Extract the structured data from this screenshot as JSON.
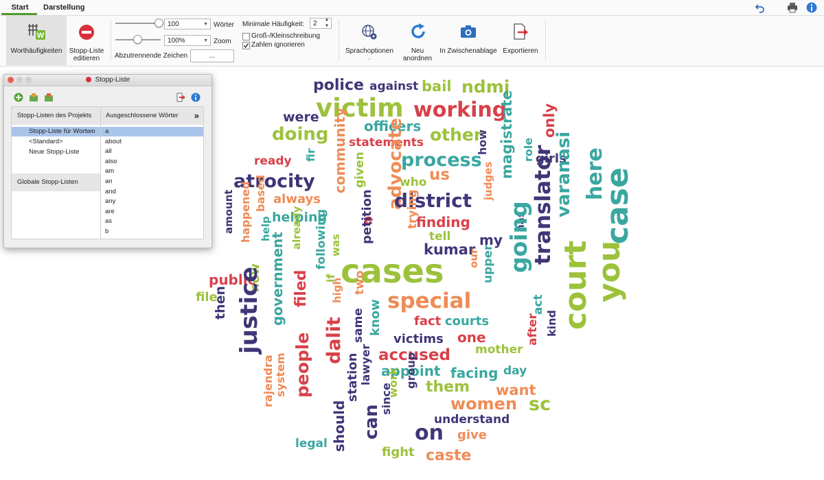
{
  "tabs": {
    "start": "Start",
    "darstellung": "Darstellung"
  },
  "ribbon": {
    "worthaeufigkeiten": "Worthäufigkeiten",
    "stoppliste_editieren": [
      "Stopp-Liste",
      "editieren"
    ],
    "words_value": "100",
    "words_label": "Wörter",
    "zoom_value": "100%",
    "zoom_label": "Zoom",
    "abzutrennende_label": "Abzutrennende Zeichen",
    "abzutrennende_button": "...",
    "min_haeufigkeit_label": "Minimale Häufigkeit:",
    "min_haeufigkeit_value": "2",
    "gross_klein_label": "Groß-/Kleinschreibung",
    "gross_klein_checked": false,
    "zahlen_ignorieren_label": "Zahlen ignorieren",
    "zahlen_ignorieren_checked": true,
    "sprachoptionen": "Sprachoptionen",
    "neu_anordnen": [
      "Neu",
      "anordnen"
    ],
    "in_zwischenablage": "In Zwischenablage",
    "exportieren": "Exportieren"
  },
  "colors": {
    "accent": "#4e9a2a",
    "purple": "#3f3677",
    "green": "#9cc23c",
    "orange": "#ef8c56",
    "teal": "#3aa7a0",
    "red": "#d8414a"
  },
  "stopplist_panel": {
    "title": "Stopp-Liste",
    "left_header": "Stopp-Listen des Projekts",
    "right_header": "Ausgeschlossene Wörter",
    "project_lists": [
      "Stopp-Liste für Wortwo",
      "<Standard>",
      "Neue Stopp-Liste"
    ],
    "global_header": "Globale Stopp-Listen",
    "excluded_words": [
      "a",
      "about",
      "all",
      "also",
      "am",
      "an",
      "and",
      "any",
      "are",
      "as",
      "b"
    ],
    "expand_glyph": "»"
  },
  "cloud": [
    {
      "t": "police",
      "c": "purple"
    },
    {
      "t": "against",
      "c": "purple"
    },
    {
      "t": "bail",
      "c": "green"
    },
    {
      "t": "ndmj",
      "c": "green"
    },
    {
      "t": "victim",
      "c": "green"
    },
    {
      "t": "working",
      "c": "red"
    },
    {
      "t": "were",
      "c": "purple"
    },
    {
      "t": "officers",
      "c": "teal"
    },
    {
      "t": "doing",
      "c": "green"
    },
    {
      "t": "other",
      "c": "green"
    },
    {
      "t": "statements",
      "c": "red"
    },
    {
      "t": "how",
      "c": "purple"
    },
    {
      "t": "magistrate",
      "c": "teal"
    },
    {
      "t": "only",
      "c": "red"
    },
    {
      "t": "ready",
      "c": "red"
    },
    {
      "t": "fir",
      "c": "teal"
    },
    {
      "t": "community",
      "c": "orange"
    },
    {
      "t": "given",
      "c": "green"
    },
    {
      "t": "advocate",
      "c": "orange"
    },
    {
      "t": "process",
      "c": "teal"
    },
    {
      "t": "role",
      "c": "teal"
    },
    {
      "t": "girls",
      "c": "purple"
    },
    {
      "t": "atrocity",
      "c": "purple"
    },
    {
      "t": "us",
      "c": "orange"
    },
    {
      "t": "who",
      "c": "green"
    },
    {
      "t": "judges",
      "c": "orange"
    },
    {
      "t": "varanasi",
      "c": "teal"
    },
    {
      "t": "here",
      "c": "teal"
    },
    {
      "t": "always",
      "c": "orange"
    },
    {
      "t": "district",
      "c": "purple"
    },
    {
      "t": "based",
      "c": "orange"
    },
    {
      "t": "e",
      "c": "red"
    },
    {
      "t": "finding",
      "c": "red"
    },
    {
      "t": "translator",
      "c": "purple"
    },
    {
      "t": "helping",
      "c": "teal"
    },
    {
      "t": "petition",
      "c": "purple"
    },
    {
      "t": "trying",
      "c": "orange"
    },
    {
      "t": "tell",
      "c": "green"
    },
    {
      "t": "has",
      "c": "purple"
    },
    {
      "t": "amount",
      "c": "purple"
    },
    {
      "t": "happened",
      "c": "orange"
    },
    {
      "t": "help",
      "c": "teal"
    },
    {
      "t": "already",
      "c": "green"
    },
    {
      "t": "was",
      "c": "green"
    },
    {
      "t": "kumar",
      "c": "purple"
    },
    {
      "t": "my",
      "c": "purple"
    },
    {
      "t": "case",
      "c": "teal"
    },
    {
      "t": "you",
      "c": "green"
    },
    {
      "t": "following",
      "c": "teal"
    },
    {
      "t": "cases",
      "c": "green"
    },
    {
      "t": "our",
      "c": "orange"
    },
    {
      "t": "going",
      "c": "teal"
    },
    {
      "t": "public",
      "c": "red"
    },
    {
      "t": "upper",
      "c": "teal"
    },
    {
      "t": "court",
      "c": "green"
    },
    {
      "t": "file",
      "c": "green"
    },
    {
      "t": "government",
      "c": "teal"
    },
    {
      "t": "filed",
      "c": "red"
    },
    {
      "t": "if",
      "c": "green"
    },
    {
      "t": "high",
      "c": "orange"
    },
    {
      "t": "special",
      "c": "orange"
    },
    {
      "t": "now",
      "c": "green"
    },
    {
      "t": "justice",
      "c": "purple"
    },
    {
      "t": "then",
      "c": "purple"
    },
    {
      "t": "two",
      "c": "orange"
    },
    {
      "t": "fact",
      "c": "red"
    },
    {
      "t": "courts",
      "c": "teal"
    },
    {
      "t": "act",
      "c": "teal"
    },
    {
      "t": "know",
      "c": "teal"
    },
    {
      "t": "same",
      "c": "purple"
    },
    {
      "t": "dalit",
      "c": "red"
    },
    {
      "t": "victims",
      "c": "purple"
    },
    {
      "t": "one",
      "c": "red"
    },
    {
      "t": "after",
      "c": "red"
    },
    {
      "t": "kind",
      "c": "purple"
    },
    {
      "t": "mother",
      "c": "green"
    },
    {
      "t": "accused",
      "c": "red"
    },
    {
      "t": "people",
      "c": "red"
    },
    {
      "t": "appoint",
      "c": "teal"
    },
    {
      "t": "facing",
      "c": "teal"
    },
    {
      "t": "day",
      "c": "teal"
    },
    {
      "t": "lawyer",
      "c": "purple"
    },
    {
      "t": "rajendra",
      "c": "orange"
    },
    {
      "t": "system",
      "c": "orange"
    },
    {
      "t": "work",
      "c": "green"
    },
    {
      "t": "group",
      "c": "purple"
    },
    {
      "t": "them",
      "c": "green"
    },
    {
      "t": "want",
      "c": "orange"
    },
    {
      "t": "station",
      "c": "purple"
    },
    {
      "t": "women",
      "c": "orange"
    },
    {
      "t": "sc",
      "c": "green"
    },
    {
      "t": "since",
      "c": "purple"
    },
    {
      "t": "understand",
      "c": "purple"
    },
    {
      "t": "can",
      "c": "purple"
    },
    {
      "t": "should",
      "c": "purple"
    },
    {
      "t": "on",
      "c": "purple"
    },
    {
      "t": "give",
      "c": "orange"
    },
    {
      "t": "legal",
      "c": "teal"
    },
    {
      "t": "fight",
      "c": "green"
    },
    {
      "t": "caste",
      "c": "orange"
    }
  ]
}
